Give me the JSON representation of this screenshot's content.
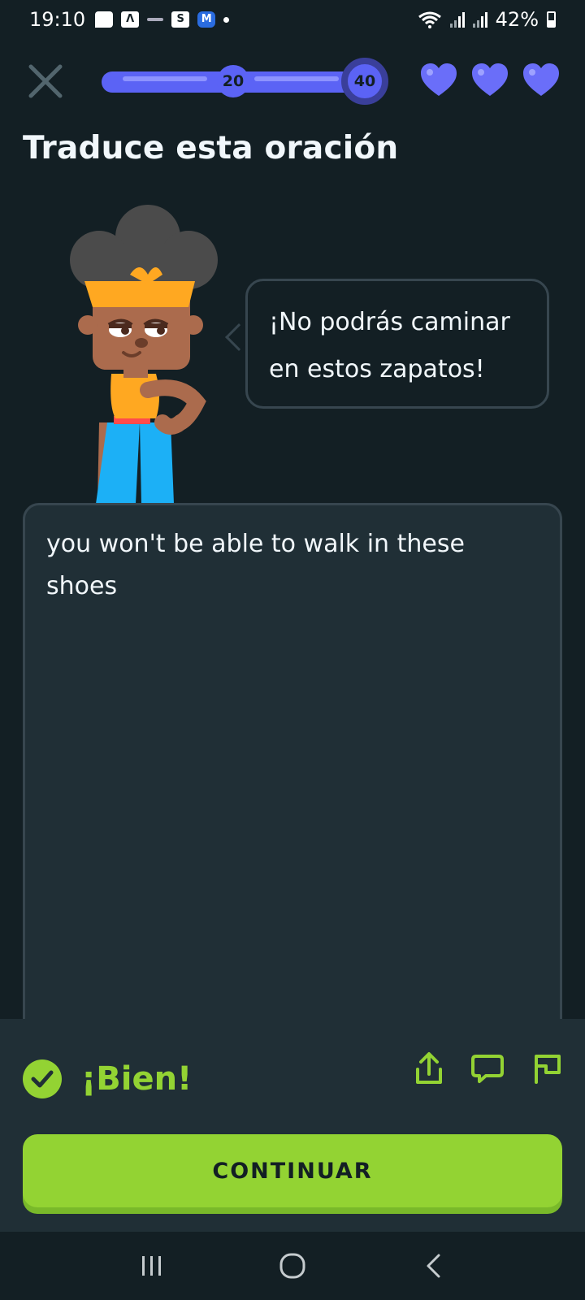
{
  "status_bar": {
    "time": "19:10",
    "battery": "42%",
    "notification_icons": [
      "message-icon",
      "app-icon-a",
      "app-icon-dash",
      "app-icon-s",
      "app-icon-m",
      "more-dot"
    ],
    "blue_app_letter": "M",
    "s_app_letter": "S",
    "a_app_letter": "Λ"
  },
  "header": {
    "progress_value": 0.5,
    "milestone_1": "20",
    "milestone_2": "40",
    "hearts_count": 3
  },
  "lesson": {
    "instruction": "Traduce esta oración",
    "prompt_sentence": "¡No podrás caminar en estos zapatos!",
    "user_answer": "you won't be able to walk in these shoes"
  },
  "feedback": {
    "result": "¡Bien!",
    "continue_label": "CONTINUAR"
  },
  "colors": {
    "background": "#131f24",
    "surface": "#202f36",
    "border": "#37464f",
    "accent_blue": "#5b63f5",
    "success_green": "#93d333",
    "text": "#f1f7fb"
  }
}
